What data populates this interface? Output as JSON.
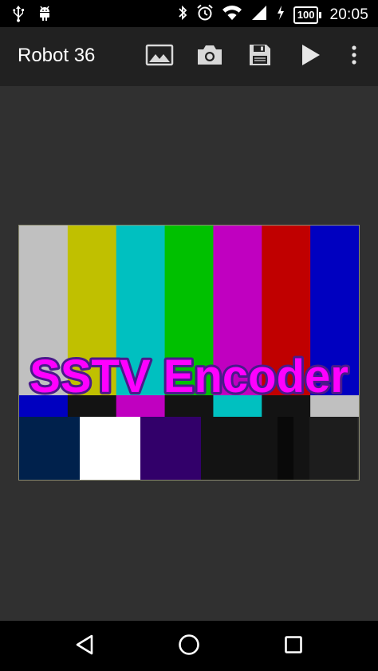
{
  "status_bar": {
    "left_icons": [
      "usb-icon",
      "android-debug-icon"
    ],
    "right_icons": [
      "bluetooth-icon",
      "alarm-icon",
      "wifi-icon",
      "cell-signal-icon",
      "charging-icon"
    ],
    "battery_level": "100",
    "time": "20:05"
  },
  "app_bar": {
    "title": "Robot 36",
    "actions": [
      {
        "name": "pick-image",
        "icon": "image-icon"
      },
      {
        "name": "take-photo",
        "icon": "camera-icon"
      },
      {
        "name": "save",
        "icon": "save-icon"
      },
      {
        "name": "play",
        "icon": "play-icon"
      },
      {
        "name": "overflow-menu",
        "icon": "more-vert-icon"
      }
    ]
  },
  "preview": {
    "overlay_text": "SSTV Encoder",
    "text_fill": "#ff00ff",
    "text_stroke": "#4a1a8a",
    "top_bars": [
      "#c0c0c0",
      "#c0c000",
      "#00c0c0",
      "#00c000",
      "#c000c0",
      "#c00000",
      "#0000c0"
    ],
    "middle_bars": [
      "#0000c0",
      "#131313",
      "#c000c0",
      "#131313",
      "#00c0c0",
      "#131313",
      "#c0c0c0"
    ],
    "bottom_blocks": [
      "#00214c",
      "#ffffff",
      "#32006a",
      "#131313",
      "#131313",
      "#090909",
      "#131313",
      "#1d1d1d",
      "#131313"
    ]
  },
  "nav_bar": {
    "buttons": [
      "back-icon",
      "home-icon",
      "recents-icon"
    ]
  },
  "colors": {
    "status_bar_bg": "#000000",
    "app_bar_bg": "#212121",
    "content_bg": "#303030",
    "nav_bar_bg": "#000000",
    "icon_color": "#ffffff"
  }
}
